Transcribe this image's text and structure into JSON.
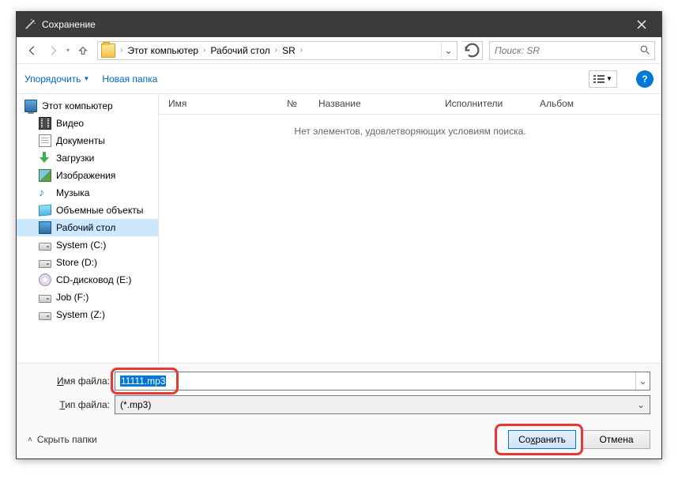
{
  "titlebar": {
    "title": "Сохранение"
  },
  "breadcrumb": {
    "items": [
      "Этот компьютер",
      "Рабочий стол",
      "SR"
    ]
  },
  "search": {
    "placeholder": "Поиск: SR"
  },
  "toolbar": {
    "organize": "Упорядочить",
    "newfolder": "Новая папка"
  },
  "tree": {
    "items": [
      {
        "label": "Этот компьютер",
        "icon": "ic-pc",
        "indent": false
      },
      {
        "label": "Видео",
        "icon": "ic-video",
        "indent": true
      },
      {
        "label": "Документы",
        "icon": "ic-doc",
        "indent": true
      },
      {
        "label": "Загрузки",
        "icon": "ic-dl",
        "indent": true
      },
      {
        "label": "Изображения",
        "icon": "ic-img",
        "indent": true
      },
      {
        "label": "Музыка",
        "icon": "ic-music",
        "indent": true
      },
      {
        "label": "Объемные объекты",
        "icon": "ic-box",
        "indent": true
      },
      {
        "label": "Рабочий стол",
        "icon": "ic-desk",
        "indent": true,
        "selected": true
      },
      {
        "label": "System (C:)",
        "icon": "ic-drive",
        "indent": true
      },
      {
        "label": "Store (D:)",
        "icon": "ic-drive",
        "indent": true
      },
      {
        "label": "CD-дисковод (E:)",
        "icon": "ic-cd",
        "indent": true
      },
      {
        "label": "Job (F:)",
        "icon": "ic-drive",
        "indent": true
      },
      {
        "label": "System (Z:)",
        "icon": "ic-drive",
        "indent": true
      }
    ]
  },
  "columns": [
    "Имя",
    "№",
    "Название",
    "Исполнители",
    "Альбом"
  ],
  "empty_message": "Нет элементов, удовлетворяющих условиям поиска.",
  "fields": {
    "filename_label_pre": "",
    "filename_label_u": "И",
    "filename_label_post": "мя файла:",
    "filename_value": "11111.mp3",
    "filetype_label_u": "Т",
    "filetype_label_post": "ип файла:",
    "filetype_value": "(*.mp3)"
  },
  "actions": {
    "hide_folders": "Скрыть папки",
    "save_pre": "Со",
    "save_u": "х",
    "save_post": "ранить",
    "cancel": "Отмена"
  },
  "help": "?"
}
